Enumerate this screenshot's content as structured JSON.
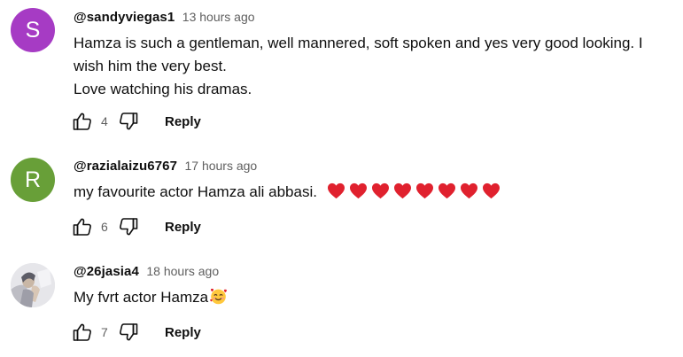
{
  "comments": [
    {
      "avatar_letter": "S",
      "avatar_color": "#a63bc4",
      "author": "@sandyviegas1",
      "time": "13 hours ago",
      "text_lines": [
        "Hamza is such a gentleman,  well mannered, soft spoken and yes very good looking. I",
        "wish him the very best.",
        "Love watching his dramas."
      ],
      "likes": "4",
      "reply_label": "Reply"
    },
    {
      "avatar_letter": "R",
      "avatar_color": "#689f38",
      "author": "@razialaizu6767",
      "time": "17 hours ago",
      "text": "my favourite actor Hamza ali abbasi.",
      "emoji": [
        "red-heart",
        "red-heart",
        "red-heart",
        "red-heart",
        "red-heart",
        "red-heart",
        "red-heart",
        "red-heart"
      ],
      "likes": "6",
      "reply_label": "Reply"
    },
    {
      "avatar_image": "praying-person-photo",
      "author": "@26jasia4",
      "time": "18 hours ago",
      "text": "My fvrt actor Hamza",
      "emoji": [
        "smiling-face-with-hearts"
      ],
      "likes": "7",
      "reply_label": "Reply"
    }
  ],
  "colors": {
    "heart": "#e0212e",
    "muted_text": "#606060",
    "text": "#0f0f0f"
  }
}
